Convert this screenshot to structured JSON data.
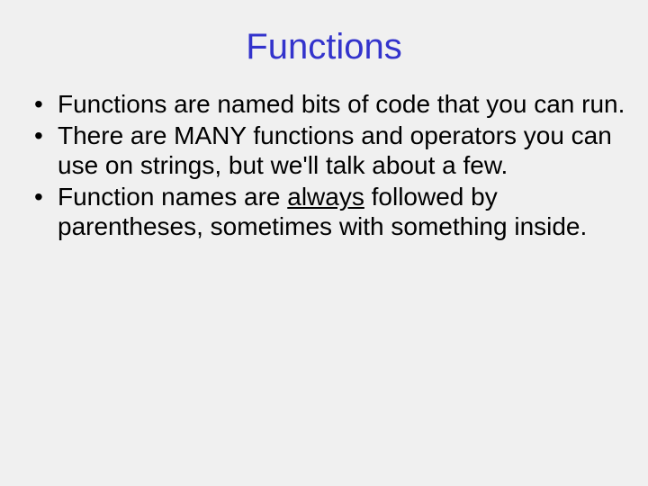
{
  "title": "Functions",
  "bullets": [
    {
      "pre": "Functions are named bits of code that you can run.",
      "u": "",
      "post": ""
    },
    {
      "pre": "There are MANY functions and operators you can use on strings, but we'll talk about a few.",
      "u": "",
      "post": ""
    },
    {
      "pre": "Function names are ",
      "u": "always",
      "post": " followed by parentheses, sometimes with something inside."
    }
  ]
}
